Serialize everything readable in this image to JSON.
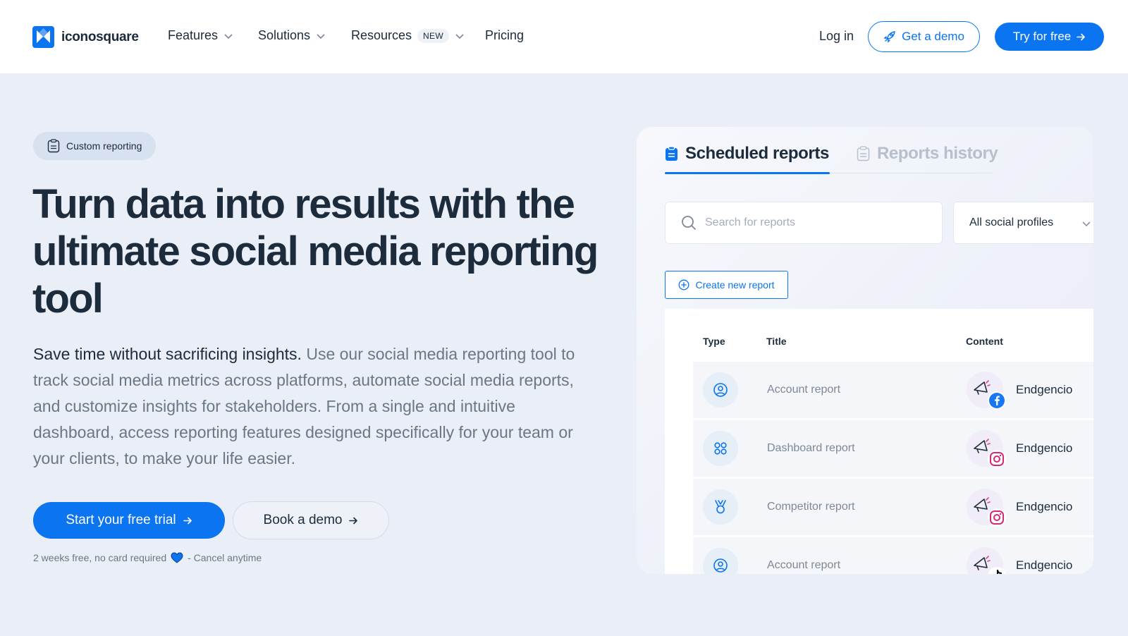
{
  "nav": {
    "brand": "iconosquare",
    "items": [
      {
        "label": "Features"
      },
      {
        "label": "Solutions"
      },
      {
        "label": "Resources",
        "badge": "NEW"
      },
      {
        "label": "Pricing"
      }
    ],
    "login": "Log in",
    "demo": "Get a demo",
    "try": "Try for free"
  },
  "hero": {
    "chip": "Custom reporting",
    "headline": "Turn data into results with the ultimate social media reporting tool",
    "lead_strong": "Save time without sacrificing insights.",
    "lead_rest": " Use our social media reporting tool to track social media metrics across platforms, automate social media reports, and customize insights for stakeholders. From a single and intuitive dashboard, access reporting features designed specifically for your team or your clients, to make your life easier.",
    "cta_primary": "Start your free trial",
    "cta_secondary": "Book a demo",
    "note_before": "2 weeks free, no card required",
    "note_after": "- Cancel anytime"
  },
  "panel": {
    "tab_active": "Scheduled reports",
    "tab_inactive": "Reports history",
    "search_placeholder": "Search for reports",
    "profile_select": "All social profiles",
    "create": "Create new report",
    "columns": {
      "type": "Type",
      "title": "Title",
      "content": "Content"
    },
    "rows": [
      {
        "title": "Account report",
        "content": "Endgencio",
        "type_icon": "user-circle-icon",
        "network": "facebook"
      },
      {
        "title": "Dashboard report",
        "content": "Endgencio",
        "type_icon": "grid-icon",
        "network": "instagram"
      },
      {
        "title": "Competitor report",
        "content": "Endgencio",
        "type_icon": "medal-icon",
        "network": "instagram"
      },
      {
        "title": "Account report",
        "content": "Endgencio",
        "type_icon": "user-circle-icon",
        "network": "tiktok"
      }
    ]
  },
  "colors": {
    "accent": "#0b74f0",
    "heading": "#1d2c3c",
    "hero_bg": "#e9eef7",
    "muted": "#6c7785"
  }
}
